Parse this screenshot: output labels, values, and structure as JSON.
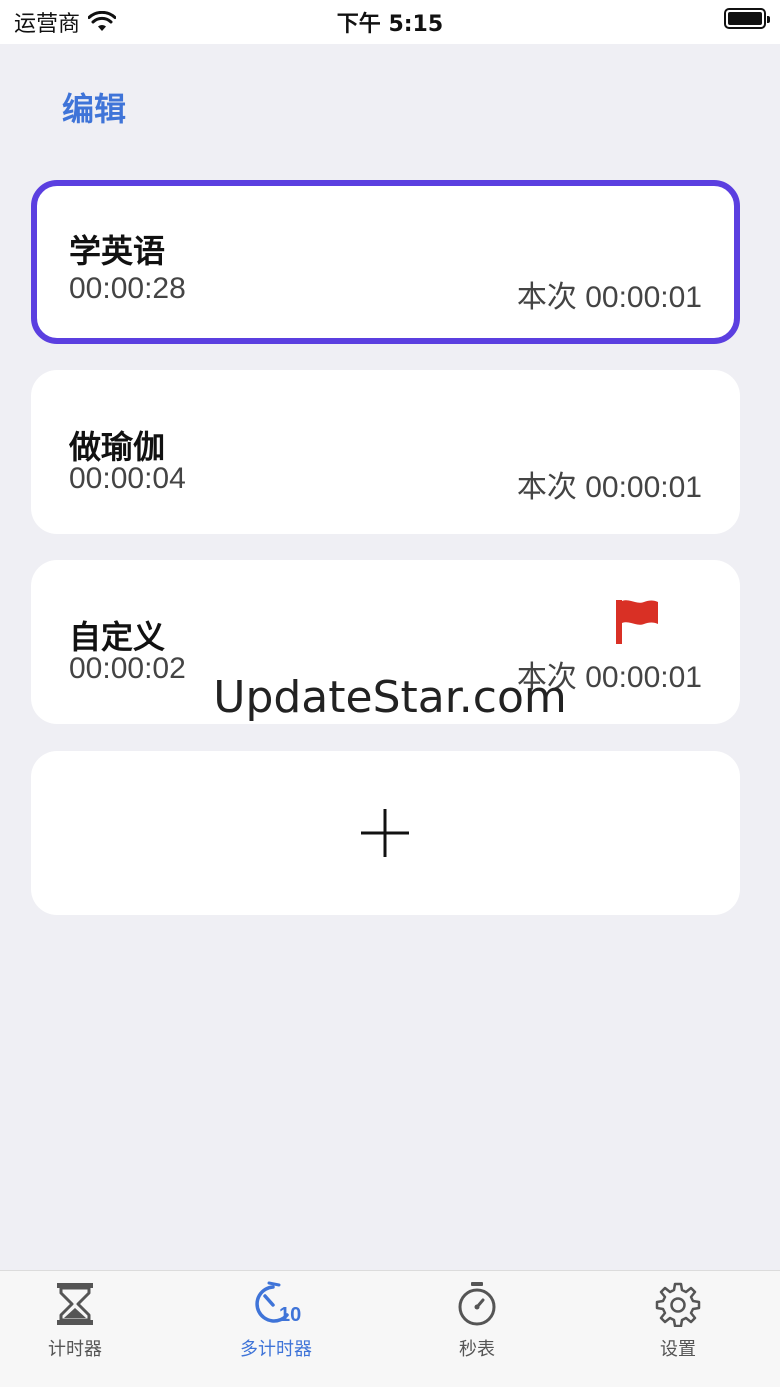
{
  "status_bar": {
    "carrier": "运营商",
    "time": "下午 5:15"
  },
  "header": {
    "edit_label": "编辑"
  },
  "timers": [
    {
      "name": "学英语",
      "total": "00:00:28",
      "session": "本次 00:00:01",
      "selected": true,
      "flagged": false
    },
    {
      "name": "做瑜伽",
      "total": "00:00:04",
      "session": "本次 00:00:01",
      "selected": false,
      "flagged": false
    },
    {
      "name": "自定义",
      "total": "00:00:02",
      "session": "本次 00:00:01",
      "selected": false,
      "flagged": true
    }
  ],
  "watermark": "UpdateStar.com",
  "tab_bar": {
    "items": [
      {
        "label": "计时器",
        "icon": "hourglass-icon"
      },
      {
        "label": "多计时器",
        "icon": "multi-timer-icon",
        "badge": "10",
        "active": true
      },
      {
        "label": "秒表",
        "icon": "stopwatch-icon"
      },
      {
        "label": "设置",
        "icon": "gear-icon"
      }
    ]
  },
  "colors": {
    "accent": "#3f74d8",
    "selected_border": "#5b3fe0",
    "flag": "#d93025",
    "background": "#efeff4"
  }
}
